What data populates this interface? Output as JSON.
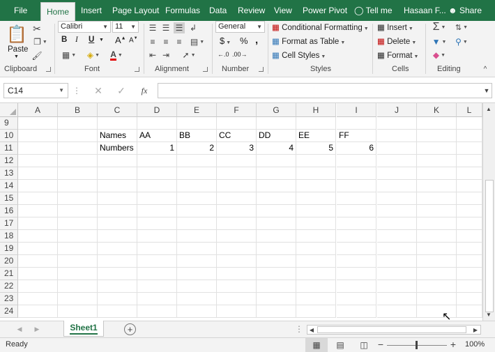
{
  "ribbon_tabs": [
    "File",
    "Home",
    "Insert",
    "Page Layout",
    "Formulas",
    "Data",
    "Review",
    "View",
    "Power Pivot"
  ],
  "tell_me": "Tell me",
  "user_name": "Hasaan F...",
  "share_label": "Share",
  "clipboard": {
    "paste_label": "Paste",
    "group_label": "Clipboard"
  },
  "font": {
    "name": "Calibri",
    "size": "11",
    "group_label": "Font",
    "bold": "B",
    "italic": "I",
    "underline": "U"
  },
  "alignment": {
    "group_label": "Alignment"
  },
  "number": {
    "format": "General",
    "currency": "$",
    "percent": "%",
    "comma": ",",
    "group_label": "Number"
  },
  "styles": {
    "conditional": "Conditional Formatting",
    "format_table": "Format as Table",
    "cell_styles": "Cell Styles",
    "group_label": "Styles"
  },
  "cells_group": {
    "insert": "Insert",
    "delete": "Delete",
    "format": "Format",
    "group_label": "Cells"
  },
  "editing": {
    "group_label": "Editing"
  },
  "formula_bar": {
    "name_box": "C14",
    "fx": "fx",
    "formula": ""
  },
  "columns": [
    "A",
    "B",
    "C",
    "D",
    "E",
    "F",
    "G",
    "H",
    "I",
    "J",
    "K",
    "L"
  ],
  "rows": [
    "9",
    "10",
    "11",
    "12",
    "13",
    "14",
    "15",
    "16",
    "17",
    "18",
    "19",
    "20",
    "21",
    "22",
    "23",
    "24"
  ],
  "cells": {
    "C10": "Names",
    "D10": "AA",
    "E10": "BB",
    "F10": "CC",
    "G10": "DD",
    "H10": "EE",
    "I10": "FF",
    "C11": "Numbers",
    "D11": "1",
    "E11": "2",
    "F11": "3",
    "G11": "4",
    "H11": "5",
    "I11": "6"
  },
  "sheet_tab": "Sheet1",
  "status": "Ready",
  "zoom": "100%",
  "colors": {
    "accent": "#217346",
    "ribbon_bg": "#f3f3f3",
    "grid_line": "#e1e1e1"
  }
}
